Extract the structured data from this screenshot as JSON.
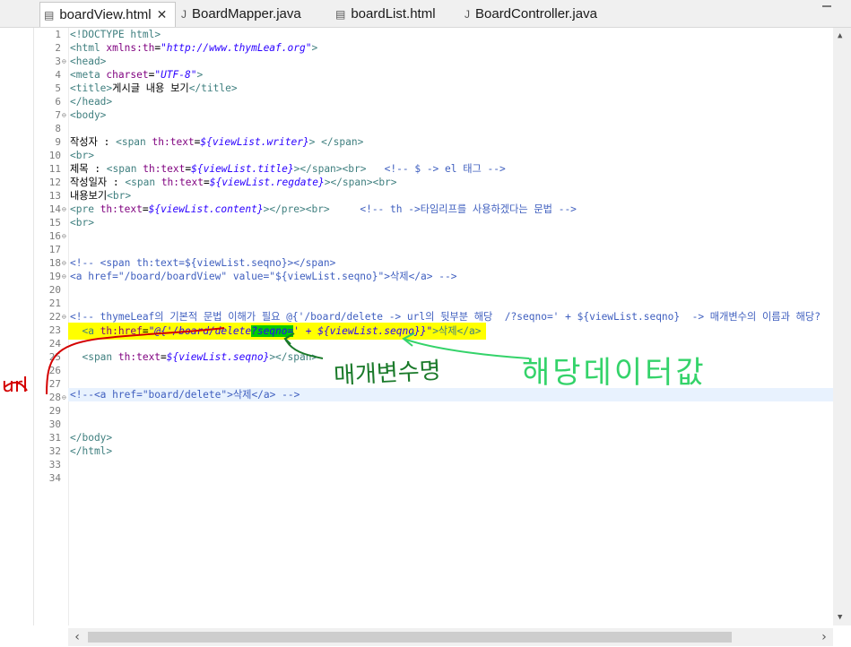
{
  "tabs": [
    {
      "label": "boardView.html",
      "icon": "html-file-icon",
      "active": true
    },
    {
      "label": "BoardMapper.java",
      "icon": "java-file-icon"
    },
    {
      "label": "boardList.html",
      "icon": "html-file-icon"
    },
    {
      "label": "BoardController.java",
      "icon": "java-file-icon"
    }
  ],
  "line_numbers": [
    "1",
    "2",
    "3",
    "4",
    "5",
    "6",
    "7",
    "8",
    "9",
    "10",
    "11",
    "12",
    "13",
    "14",
    "15",
    "16",
    "17",
    "18",
    "19",
    "20",
    "21",
    "22",
    "23",
    "24",
    "25",
    "26",
    "27",
    "28",
    "29",
    "30",
    "31",
    "32",
    "33",
    "34"
  ],
  "code": {
    "l1a": "<!DOCTYPE ",
    "l1b": "html",
    "l1c": ">",
    "l2a": "<html ",
    "l2b": "xmlns:th",
    "l2c": "=",
    "l2d": "\"http://www.thymLeaf.org\"",
    "l2e": ">",
    "l3": "<head>",
    "l4a": "<meta ",
    "l4b": "charset",
    "l4c": "=",
    "l4d": "\"UTF-8\"",
    "l4e": ">",
    "l5a": "<title>",
    "l5b": "게시글 내용 보기",
    "l5c": "</title>",
    "l6": "</head>",
    "l7": "<body>",
    "l9a": "작성자 : ",
    "l9b": "<span ",
    "l9c": "th:text",
    "l9d": "=",
    "l9e": "${viewList.writer}",
    "l9f": "> ",
    "l9g": "</span>",
    "l10": "<br>",
    "l11a": "제목 : ",
    "l11b": "<span ",
    "l11c": "th:text",
    "l11d": "=",
    "l11e": "${viewList.title}",
    "l11f": "></span><br>",
    "l11g": "   <!-- $ -> el 태그 -->",
    "l12a": "작성일자 : ",
    "l12b": "<span ",
    "l12c": "th:text",
    "l12d": "=",
    "l12e": "${viewList.regdate}",
    "l12f": "></span><br>",
    "l13a": "내용보기",
    "l13b": "<br>",
    "l14a": "<pre ",
    "l14b": "th:text",
    "l14c": "=",
    "l14d": "${viewList.content}",
    "l14e": "></pre><br>",
    "l14f": "     <!-- th ->타임리프를 사용하겠다는 문법 -->",
    "l15": "<br>",
    "l18": "<!-- <span th:text=${viewList.seqno}></span>",
    "l19": "<a href=\"/board/boardView\" value=\"${viewList.seqno}\">삭제</a> -->",
    "l22": "<!-- thymeLeaf의 기본적 문법 이해가 필요 @{'/board/delete -> url의 뒷부분 해당  /?seqno=' + ${viewList.seqno}  -> 매개변수의 이름과 해당?",
    "l23a": "  <a ",
    "l23b": "th:href",
    "l23c": "=",
    "l23d": "\"@{'/board/delete",
    "l23e": "?seqno=",
    "l23f": "' + ${viewList.seqno}}\"",
    "l23g": ">삭제</a>",
    "l25a": "  <span ",
    "l25b": "th:text",
    "l25c": "=",
    "l25d": "${viewList.seqno}",
    "l25e": "></span>",
    "l28": "<!--<a href=\"board/delete\">삭제</a> -->",
    "l31": "</body>",
    "l32": "</html>"
  },
  "handwriting": {
    "param_name_note": "매개변수명",
    "param_value_note": "해당데이터값",
    "url_note": "url"
  }
}
